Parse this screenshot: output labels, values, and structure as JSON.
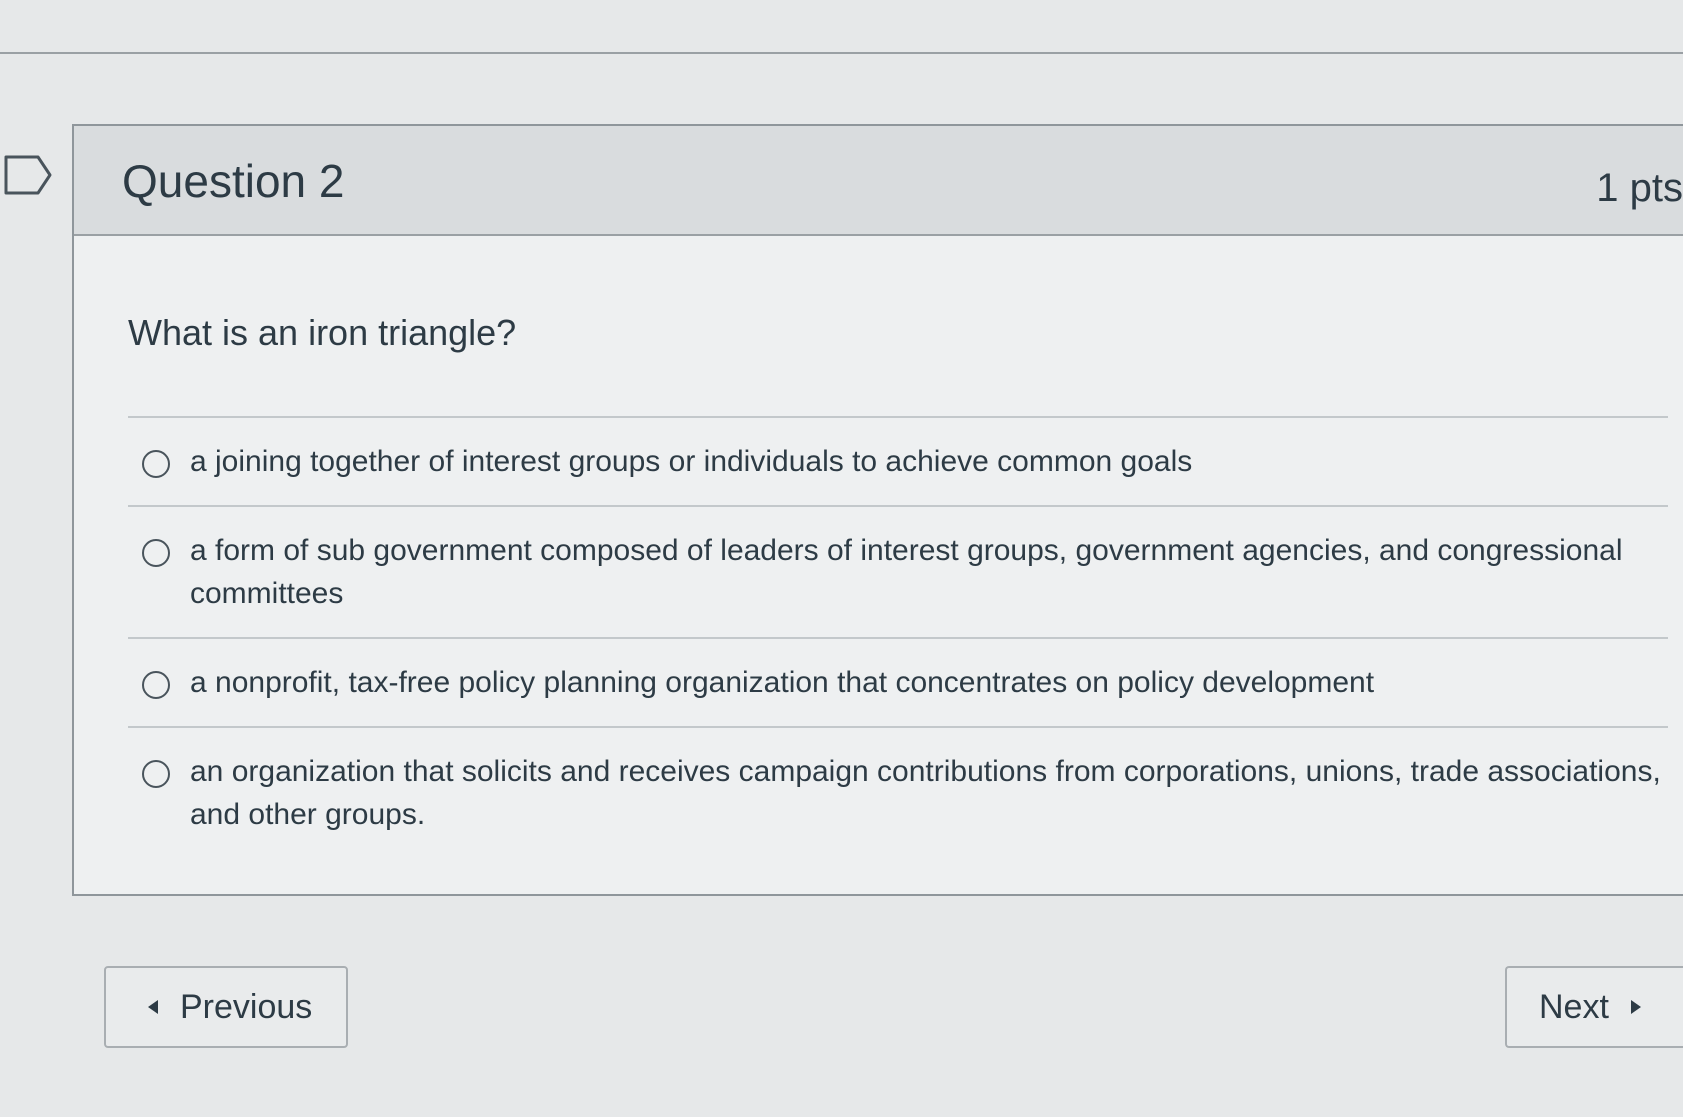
{
  "question": {
    "title": "Question 2",
    "points": "1 pts",
    "text": "What is an iron triangle?",
    "answers": [
      {
        "label": "a joining together of interest groups or individuals to achieve common goals"
      },
      {
        "label": "a form of sub government composed of leaders of interest groups, government agencies, and congressional committees"
      },
      {
        "label": "a nonprofit, tax-free policy planning organization that concentrates on policy development"
      },
      {
        "label": "an organization that solicits and receives campaign contributions from corporations, unions, trade associations, and other groups."
      }
    ]
  },
  "navigation": {
    "previous_label": "Previous",
    "next_label": "Next"
  }
}
